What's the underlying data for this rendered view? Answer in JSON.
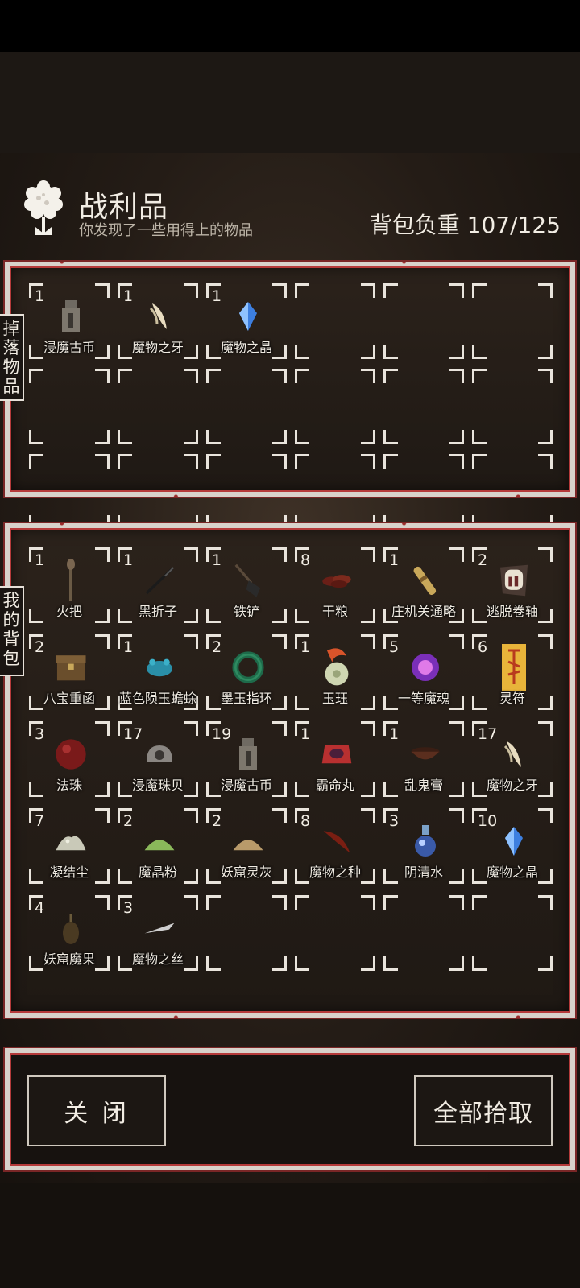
{
  "header": {
    "title": "战利品",
    "subtitle": "你发现了一些用得上的物品",
    "weight_label": "背包负重 107/125"
  },
  "drop": {
    "tag": "掉落物品",
    "items": [
      {
        "qty": "1",
        "name": "浸魔古币",
        "icon": "coin-icon"
      },
      {
        "qty": "1",
        "name": "魔物之牙",
        "icon": "fang-icon"
      },
      {
        "qty": "1",
        "name": "魔物之晶",
        "icon": "crystal-icon"
      }
    ]
  },
  "bag": {
    "tag": "我的背包",
    "items": [
      {
        "qty": "1",
        "name": "火把",
        "icon": "torch-icon"
      },
      {
        "qty": "1",
        "name": "黑折子",
        "icon": "black-stick-icon"
      },
      {
        "qty": "1",
        "name": "铁铲",
        "icon": "shovel-icon"
      },
      {
        "qty": "8",
        "name": "干粮",
        "icon": "dried-meat-icon"
      },
      {
        "qty": "1",
        "name": "庄机关通略",
        "icon": "scroll-icon"
      },
      {
        "qty": "2",
        "name": "逃脱卷轴",
        "icon": "escape-scroll-icon"
      },
      {
        "qty": "2",
        "name": "八宝重函",
        "icon": "treasure-box-icon"
      },
      {
        "qty": "1",
        "name": "蓝色陨玉蟾蜍",
        "icon": "jade-toad-icon"
      },
      {
        "qty": "2",
        "name": "墨玉指环",
        "icon": "jade-ring-icon"
      },
      {
        "qty": "1",
        "name": "玉珏",
        "icon": "jade-pendant-icon"
      },
      {
        "qty": "5",
        "name": "一等魔魂",
        "icon": "soul-orb-icon"
      },
      {
        "qty": "6",
        "name": "灵符",
        "icon": "talisman-icon"
      },
      {
        "qty": "3",
        "name": "法珠",
        "icon": "magic-bead-icon"
      },
      {
        "qty": "17",
        "name": "浸魔珠贝",
        "icon": "shell-icon"
      },
      {
        "qty": "19",
        "name": "浸魔古币",
        "icon": "coin-icon"
      },
      {
        "qty": "1",
        "name": "霸命丸",
        "icon": "pill-box-icon"
      },
      {
        "qty": "1",
        "name": "乱鬼膏",
        "icon": "ointment-bowl-icon"
      },
      {
        "qty": "17",
        "name": "魔物之牙",
        "icon": "fang-icon"
      },
      {
        "qty": "7",
        "name": "凝结尘",
        "icon": "dust-pile-icon"
      },
      {
        "qty": "2",
        "name": "魔晶粉",
        "icon": "green-powder-icon"
      },
      {
        "qty": "2",
        "name": "妖窟灵灰",
        "icon": "ash-pile-icon"
      },
      {
        "qty": "8",
        "name": "魔物之种",
        "icon": "seed-icon"
      },
      {
        "qty": "3",
        "name": "阴清水",
        "icon": "potion-icon"
      },
      {
        "qty": "10",
        "name": "魔物之晶",
        "icon": "crystal-icon"
      },
      {
        "qty": "4",
        "name": "妖窟魔果",
        "icon": "demon-fruit-icon"
      },
      {
        "qty": "3",
        "name": "魔物之丝",
        "icon": "silk-icon"
      }
    ]
  },
  "buttons": {
    "close": "关 闭",
    "pick_all": "全部拾取"
  }
}
